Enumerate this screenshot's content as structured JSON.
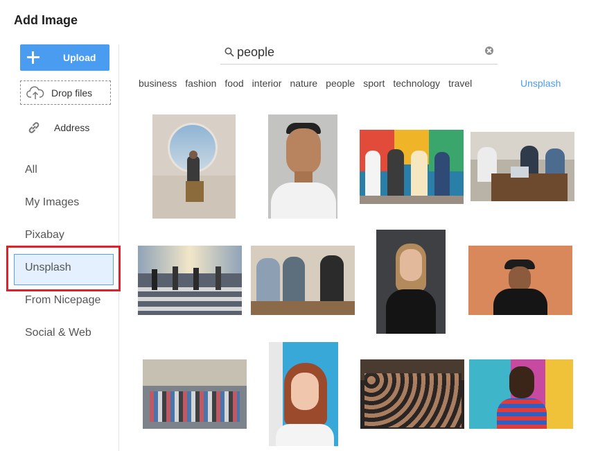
{
  "dialog": {
    "title": "Add Image"
  },
  "sidebar": {
    "upload_label": "Upload",
    "drop_label": "Drop files",
    "address_label": "Address",
    "nav": [
      {
        "label": "All"
      },
      {
        "label": "My Images"
      },
      {
        "label": "Pixabay"
      },
      {
        "label": "Unsplash",
        "active": true
      },
      {
        "label": "From Nicepage"
      },
      {
        "label": "Social & Web"
      }
    ]
  },
  "search": {
    "value": "people"
  },
  "tags": [
    "business",
    "fashion",
    "food",
    "interior",
    "nature",
    "people",
    "sport",
    "technology",
    "travel"
  ],
  "source_link": "Unsplash",
  "colors": {
    "accent": "#4a9cf0",
    "active_bg": "#e4f0fd",
    "highlight": "#e0202a"
  },
  "images": [
    {
      "name": "woman-circle-window"
    },
    {
      "name": "smiling-man-portrait"
    },
    {
      "name": "friends-mural-street"
    },
    {
      "name": "team-cafe-laptops"
    },
    {
      "name": "crosswalk-crowd"
    },
    {
      "name": "group-laughing-table"
    },
    {
      "name": "woman-dark-portrait"
    },
    {
      "name": "man-hat-orange-wall"
    },
    {
      "name": "busy-city-street"
    },
    {
      "name": "redhead-woman-blue"
    },
    {
      "name": "concert-crowd"
    },
    {
      "name": "man-graffiti-wall"
    }
  ]
}
